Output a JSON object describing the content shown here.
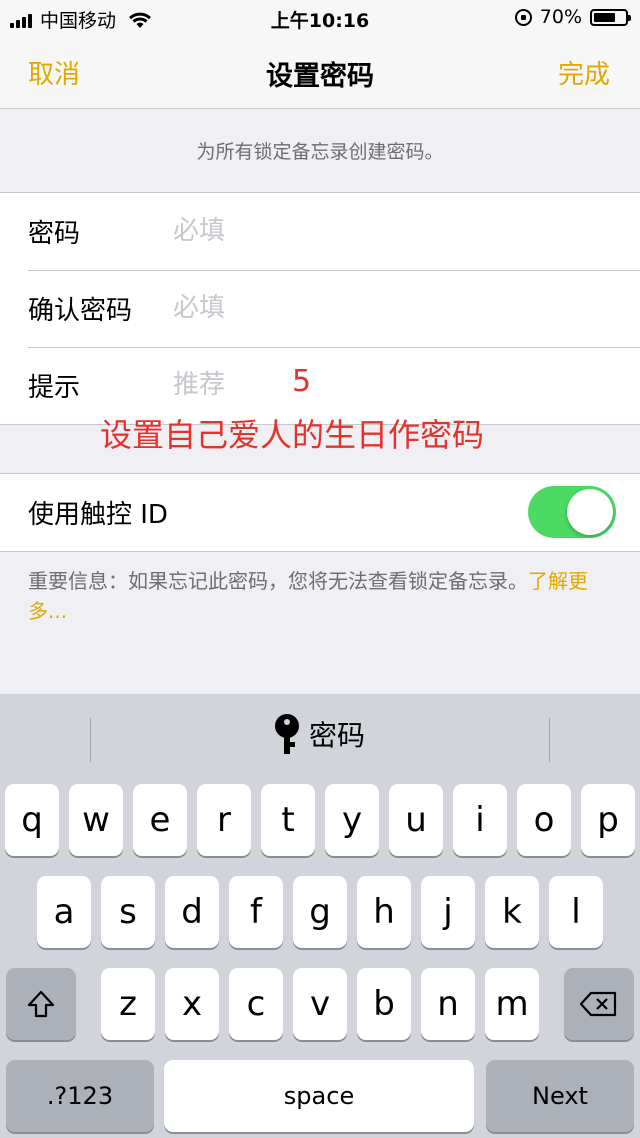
{
  "status_bar": {
    "carrier": "中国移动",
    "time": "上午10:16",
    "battery": "70%",
    "battery_level": 0.7
  },
  "nav": {
    "cancel": "取消",
    "title": "设置密码",
    "done": "完成"
  },
  "section_header": "为所有锁定备忘录创建密码。",
  "form": {
    "password_label": "密码",
    "password_placeholder": "必填",
    "confirm_label": "确认密码",
    "confirm_placeholder": "必填",
    "hint_label": "提示",
    "hint_placeholder": "推荐"
  },
  "annotation": {
    "number": "5",
    "text": "设置自己爱人的生日作密码"
  },
  "touch_id": {
    "label": "使用触控 ID",
    "enabled": true
  },
  "footer": {
    "note": "重要信息：如果忘记此密码，您将无法查看锁定备忘录。",
    "link": "了解更多..."
  },
  "keyboard": {
    "suggestion": "密码",
    "row1": [
      "q",
      "w",
      "e",
      "r",
      "t",
      "y",
      "u",
      "i",
      "o",
      "p"
    ],
    "row2": [
      "a",
      "s",
      "d",
      "f",
      "g",
      "h",
      "j",
      "k",
      "l"
    ],
    "row3": [
      "z",
      "x",
      "c",
      "v",
      "b",
      "n",
      "m"
    ],
    "numbers_label": ".?123",
    "space_label": "space",
    "next_label": "Next"
  },
  "colors": {
    "accent": "#e0a800",
    "toggle_on": "#4cd964",
    "annotation": "#e5322a"
  }
}
